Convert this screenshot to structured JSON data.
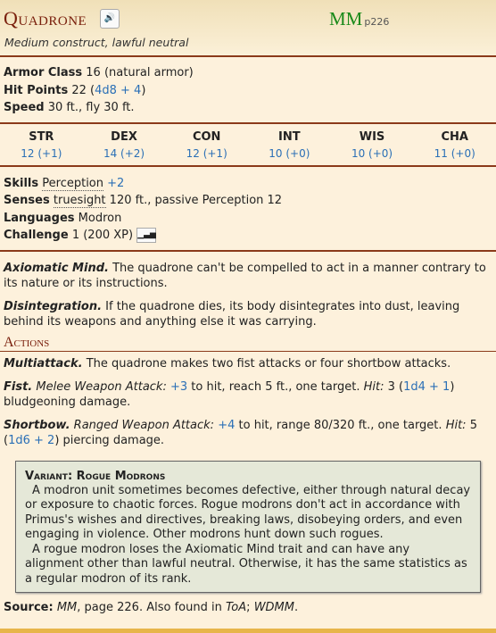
{
  "header": {
    "name": "Quadrone",
    "speak_icon": "speaker-icon",
    "source_book": "MM",
    "source_page": "p226",
    "subtitle": "Medium construct, lawful neutral"
  },
  "stats": {
    "ac_label": "Armor Class",
    "ac_value": "16 (natural armor)",
    "hp_label": "Hit Points",
    "hp_value": "22 (",
    "hp_roll": "4d8 + 4",
    "hp_close": ")",
    "speed_label": "Speed",
    "speed_value": "30 ft., fly 30 ft."
  },
  "abilities": [
    {
      "name": "STR",
      "value": "12 (+1)"
    },
    {
      "name": "DEX",
      "value": "14 (+2)"
    },
    {
      "name": "CON",
      "value": "12 (+1)"
    },
    {
      "name": "INT",
      "value": "10 (+0)"
    },
    {
      "name": "WIS",
      "value": "10 (+0)"
    },
    {
      "name": "CHA",
      "value": "11 (+0)"
    }
  ],
  "details": {
    "skills_label": "Skills",
    "skill_name": "Perception",
    "skill_bonus": "+2",
    "senses_label": "Senses",
    "senses_link": "truesight",
    "senses_value": "120 ft., passive Perception 12",
    "languages_label": "Languages",
    "languages_value": "Modron",
    "challenge_label": "Challenge",
    "challenge_value": "1 (200 XP)"
  },
  "traits": [
    {
      "name": "Axiomatic Mind.",
      "text": "The quadrone can't be compelled to act in a manner contrary to its nature or its instructions."
    },
    {
      "name": "Disintegration.",
      "text": "If the quadrone dies, its body disintegrates into dust, leaving behind its weapons and anything else it was carrying."
    }
  ],
  "actions_title": "Actions",
  "actions": {
    "multi_name": "Multiattack.",
    "multi_text": "The quadrone makes two fist attacks or four shortbow attacks.",
    "fist_name": "Fist.",
    "fist_type": "Melee Weapon Attack:",
    "fist_bonus": "+3",
    "fist_text1": "to hit, reach 5 ft., one target.",
    "fist_hit": "Hit:",
    "fist_dmg": "3 (",
    "fist_roll": "1d4 + 1",
    "fist_text2": ") bludgeoning damage.",
    "bow_name": "Shortbow.",
    "bow_type": "Ranged Weapon Attack:",
    "bow_bonus": "+4",
    "bow_text1": "to hit, range 80/320 ft., one target.",
    "bow_hit": "Hit:",
    "bow_dmg": "5 (",
    "bow_roll": "1d6 + 2",
    "bow_text2": ") piercing damage."
  },
  "variant": {
    "title": "Variant: Rogue Modrons",
    "p1": "A modron unit sometimes becomes defective, either through natural decay or exposure to chaotic forces. Rogue modrons don't act in accordance with Primus's wishes and directives, breaking laws, disobeying orders, and even engaging in violence. Other modrons hunt down such rogues.",
    "p2": "A rogue modron loses the Axiomatic Mind trait and can have any alignment other than lawful neutral. Otherwise, it has the same statistics as a regular modron of its rank."
  },
  "source": {
    "label": "Source:",
    "book": "MM",
    "text1": ", page 226. Also found in",
    "also1": "ToA",
    "sep": ";",
    "also2": "WDMM",
    "end": "."
  },
  "colors": {
    "title": "#7a200d",
    "link": "#2a6fb6",
    "source": "#1a8a1a",
    "rule": "#8b3a1a"
  }
}
